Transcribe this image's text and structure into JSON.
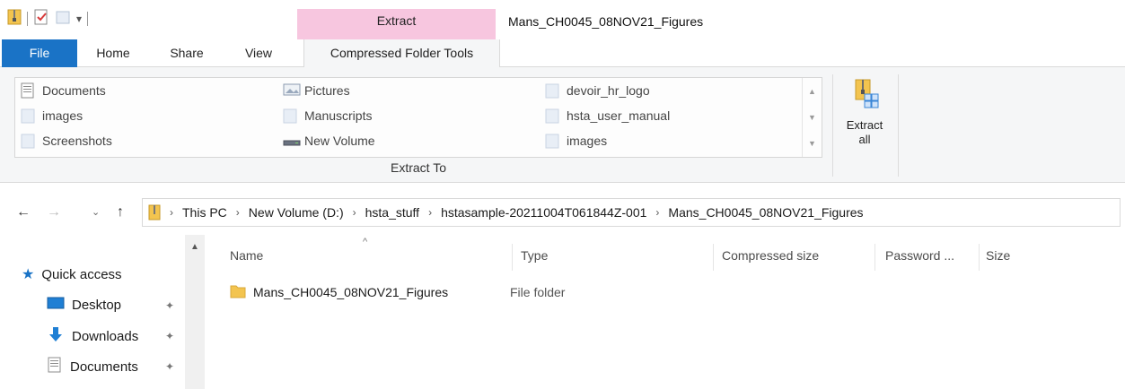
{
  "titlebar": {
    "context_tab": "Extract",
    "window_title": "Mans_CH0045_08NOV21_Figures"
  },
  "tabs": {
    "file": "File",
    "home": "Home",
    "share": "Share",
    "view": "View",
    "compressed_tools": "Compressed Folder Tools"
  },
  "ribbon": {
    "gallery": [
      {
        "label": "Documents",
        "icon": "documents-icon"
      },
      {
        "label": "images",
        "icon": "folder-icon"
      },
      {
        "label": "Screenshots",
        "icon": "folder-icon"
      },
      {
        "label": "Pictures",
        "icon": "pictures-icon"
      },
      {
        "label": "Manuscripts",
        "icon": "folder-icon"
      },
      {
        "label": "New Volume",
        "icon": "drive-icon"
      },
      {
        "label": "devoir_hr_logo",
        "icon": "folder-icon"
      },
      {
        "label": "hsta_user_manual",
        "icon": "folder-icon"
      },
      {
        "label": "images",
        "icon": "folder-icon"
      }
    ],
    "group_label": "Extract To",
    "extract_all_line1": "Extract",
    "extract_all_line2": "all"
  },
  "address": {
    "crumbs": [
      "This PC",
      "New Volume (D:)",
      "hsta_stuff",
      "hstasample-20211004T061844Z-001",
      "Mans_CH0045_08NOV21_Figures"
    ]
  },
  "navpane": {
    "quick_access": "Quick access",
    "items": [
      {
        "label": "Desktop",
        "icon": "desktop-icon"
      },
      {
        "label": "Downloads",
        "icon": "downloads-icon"
      },
      {
        "label": "Documents",
        "icon": "documents-icon"
      }
    ]
  },
  "filelist": {
    "columns": [
      "Name",
      "Type",
      "Compressed size",
      "Password ...",
      "Size"
    ],
    "rows": [
      {
        "name": "Mans_CH0045_08NOV21_Figures",
        "type": "File folder"
      }
    ]
  },
  "colors": {
    "file_tab": "#1a73c6",
    "context_tab": "#f7c6df",
    "folder": "#f3c44f"
  }
}
